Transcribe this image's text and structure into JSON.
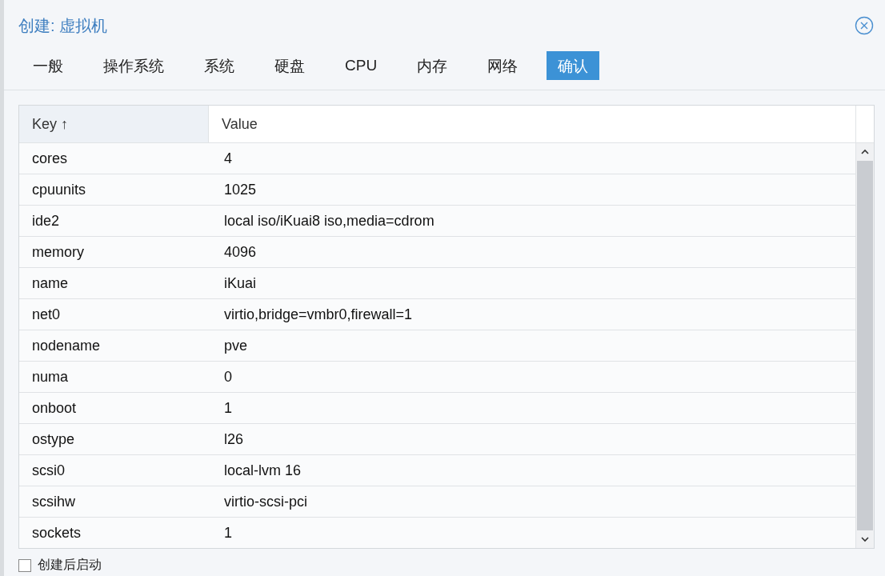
{
  "window": {
    "title": "创建: 虚拟机"
  },
  "tabs": [
    {
      "label": "一般",
      "selected": false
    },
    {
      "label": "操作系统",
      "selected": false
    },
    {
      "label": "系统",
      "selected": false
    },
    {
      "label": "硬盘",
      "selected": false
    },
    {
      "label": "CPU",
      "selected": false
    },
    {
      "label": "内存",
      "selected": false
    },
    {
      "label": "网络",
      "selected": false
    },
    {
      "label": "确认",
      "selected": true
    }
  ],
  "table": {
    "columns": [
      {
        "label": "Key",
        "sort_indicator": "↑"
      },
      {
        "label": "Value"
      }
    ],
    "rows": [
      {
        "key": "cores",
        "value": "4"
      },
      {
        "key": "cpuunits",
        "value": "1025"
      },
      {
        "key": "ide2",
        "value": "local iso/iKuai8 iso,media=cdrom"
      },
      {
        "key": "memory",
        "value": "4096"
      },
      {
        "key": "name",
        "value": "iKuai"
      },
      {
        "key": "net0",
        "value": "virtio,bridge=vmbr0,firewall=1"
      },
      {
        "key": "nodename",
        "value": "pve"
      },
      {
        "key": "numa",
        "value": "0"
      },
      {
        "key": "onboot",
        "value": "1"
      },
      {
        "key": "ostype",
        "value": "l26"
      },
      {
        "key": "scsi0",
        "value": "local-lvm 16"
      },
      {
        "key": "scsihw",
        "value": "virtio-scsi-pci"
      },
      {
        "key": "sockets",
        "value": "1"
      }
    ]
  },
  "start_after_create": {
    "label": "创建后启动",
    "checked": false
  }
}
